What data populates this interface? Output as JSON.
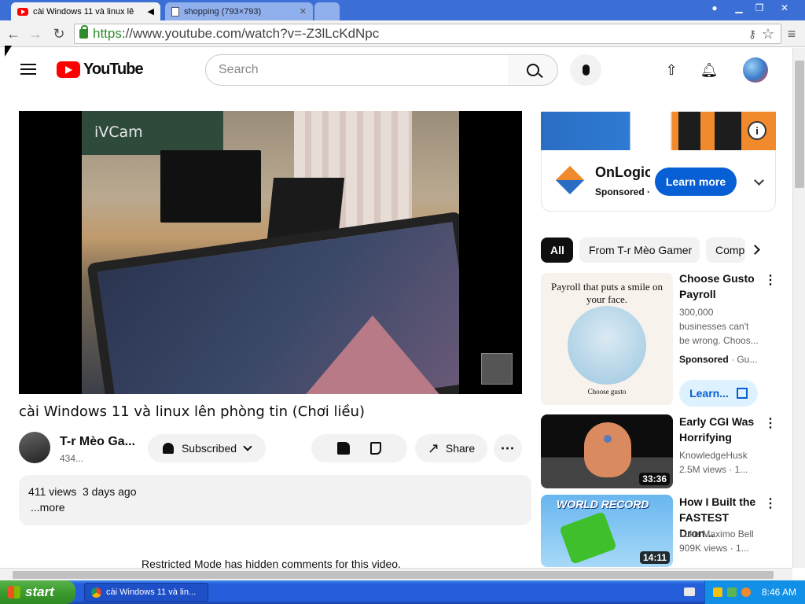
{
  "browser": {
    "tabs": [
      {
        "title": "cài Windows 11 và linux lê",
        "close": "✕"
      },
      {
        "title": "shopping (793×793)",
        "close": "✕"
      }
    ],
    "url": {
      "scheme": "https",
      "rest": "://www.youtube.com/watch?v=-Z3lLcKdNpc"
    }
  },
  "youtube": {
    "logo_text": "YouTube",
    "search_placeholder": "Search"
  },
  "player": {
    "board_text": "iVCam"
  },
  "video": {
    "title": "cài Windows 11 và linux lên phòng tin (Chơi liều)",
    "channel_name": "T-r Mèo Ga...",
    "subscribers": "434...",
    "subscribe_label": "Subscribed",
    "share_label": "Share",
    "views": "411 views",
    "age": "3 days ago",
    "more_label": "...more",
    "restricted_notice": "Restricted Mode has hidden comments for this video."
  },
  "ad": {
    "advertiser": "OnLogic",
    "sponsored": "Sponsored ·",
    "cta": "Learn more",
    "info": "i"
  },
  "chips": [
    "All",
    "From T-r Mèo Gamer",
    "Computers"
  ],
  "recommendations": [
    {
      "title": "Choose Gusto Payroll",
      "meta1": "300,000",
      "meta2": "businesses can't",
      "meta3": "be wrong. Choos...",
      "sponsored": "Sponsored",
      "sponsor_suffix": "· Gu...",
      "cta": "Learn...",
      "thumb_headline": "Payroll that puts a smile on your face.",
      "thumb_tag": "Choose gusto"
    },
    {
      "title": "Early CGI Was Horrifying",
      "channel": "KnowledgeHusk",
      "stats": "2.5M views  · 1...",
      "duration": "33:36"
    },
    {
      "title": "How I Built the FASTEST Dron...",
      "channel": "Luke Maximo Bell",
      "stats": "909K views  · 1...",
      "duration": "14:11",
      "thumb_text": "WORLD RECORD"
    }
  ],
  "taskbar": {
    "start": "start",
    "task": "cài Windows 11 và lin...",
    "clock": "8:46 AM"
  },
  "colors": {
    "yt_red": "#ff0000",
    "accent_blue": "#065fd4",
    "xp_taskbar": "#245edb",
    "xp_start": "#3c9b2f"
  }
}
